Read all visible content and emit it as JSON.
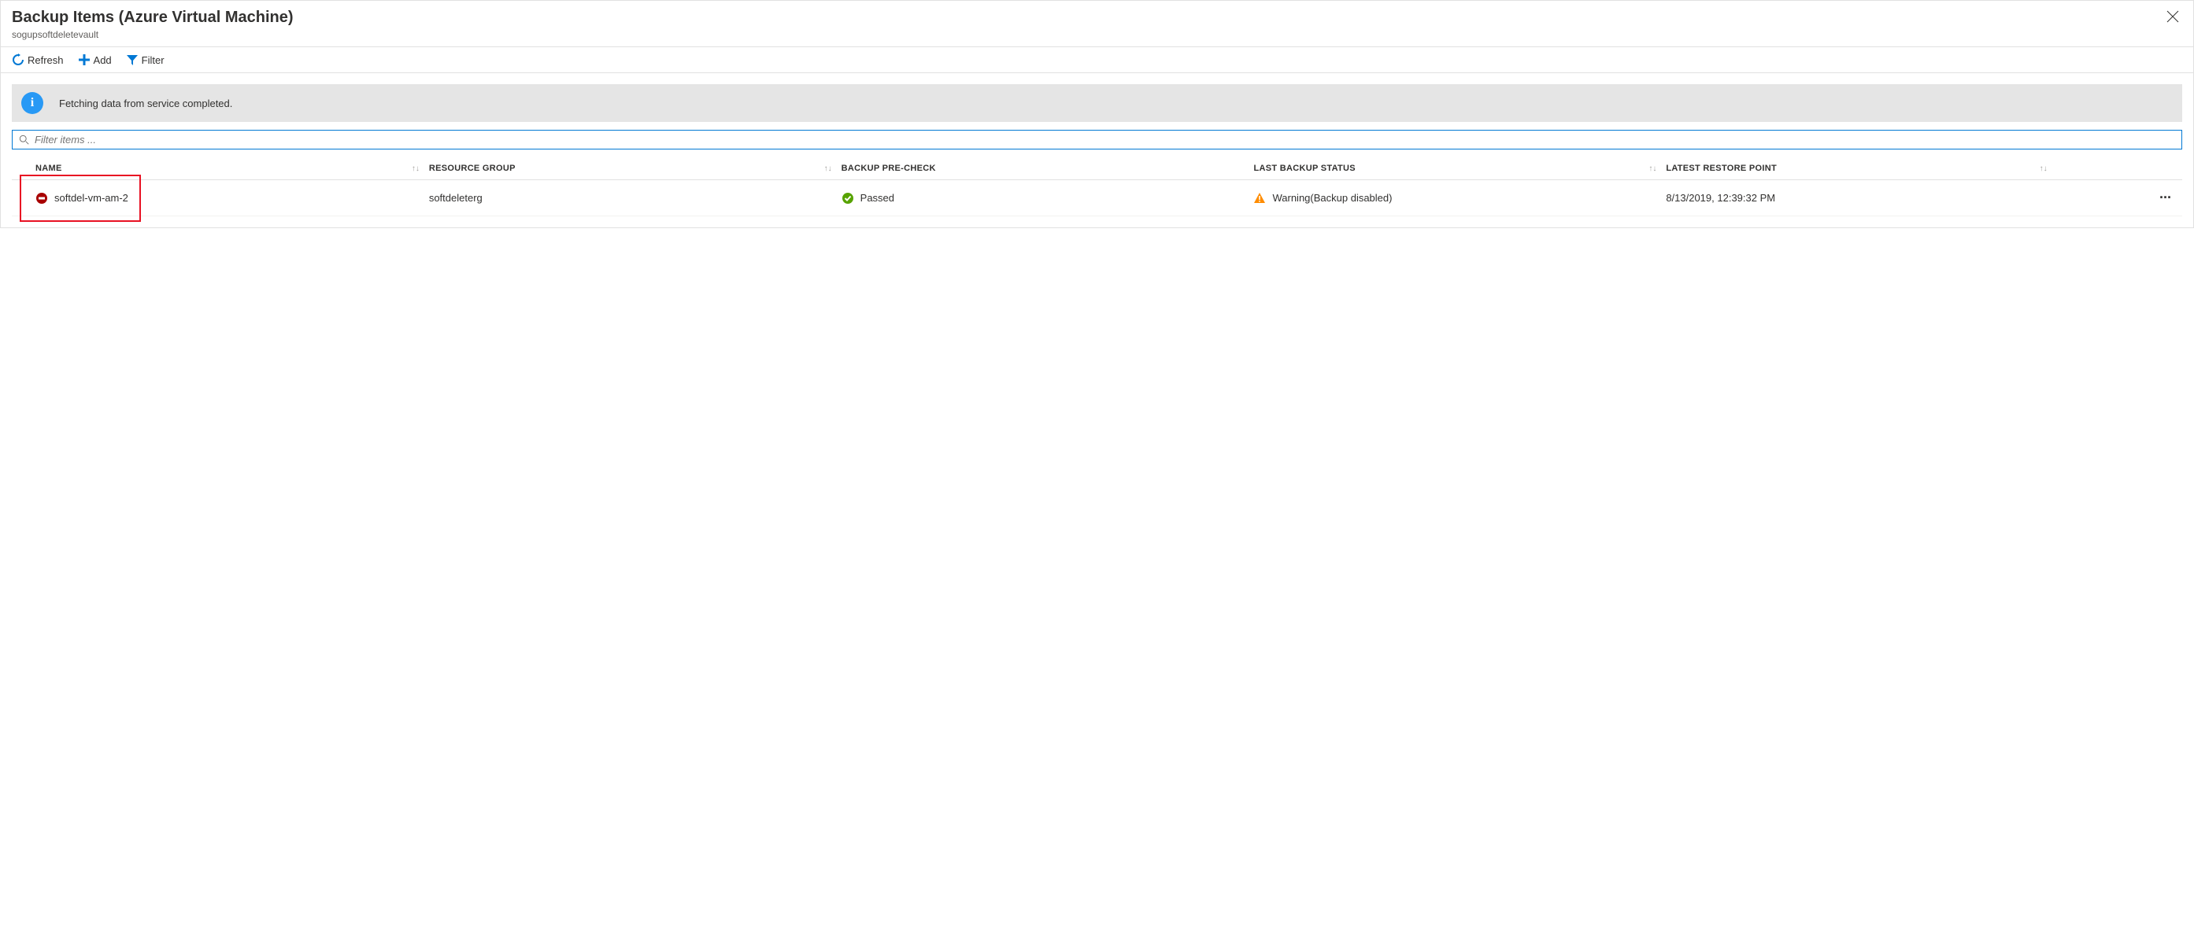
{
  "header": {
    "title": "Backup Items (Azure Virtual Machine)",
    "subtitle": "sogupsoftdeletevault"
  },
  "toolbar": {
    "refresh_label": "Refresh",
    "add_label": "Add",
    "filter_label": "Filter"
  },
  "banner": {
    "message": "Fetching data from service completed."
  },
  "search": {
    "placeholder": "Filter items ..."
  },
  "columns": {
    "name": "NAME",
    "resource_group": "RESOURCE GROUP",
    "precheck": "BACKUP PRE-CHECK",
    "status": "LAST BACKUP STATUS",
    "restore": "LATEST RESTORE POINT"
  },
  "rows": [
    {
      "name": "softdel-vm-am-2",
      "resource_group": "softdeleterg",
      "precheck": "Passed",
      "status": "Warning(Backup disabled)",
      "restore": "8/13/2019, 12:39:32 PM"
    }
  ],
  "colors": {
    "accent": "#0078d4",
    "warning": "#ff8c00",
    "success": "#57a300",
    "error": "#e81123",
    "info": "#2899f5"
  }
}
